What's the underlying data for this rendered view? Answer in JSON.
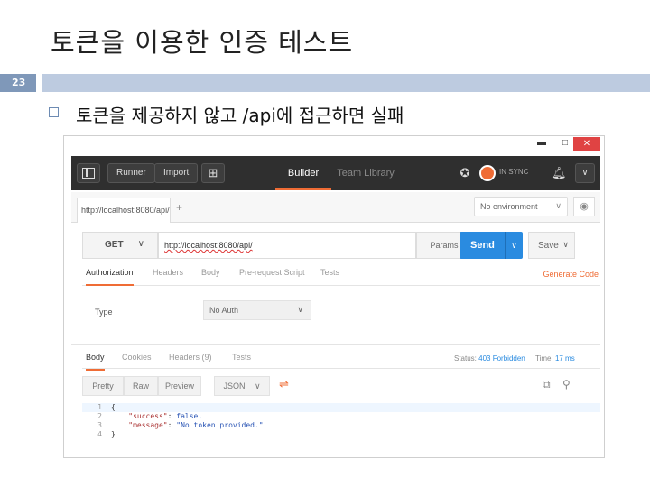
{
  "slide": {
    "title": "토큰을 이용한 인증 테스트",
    "page_number": "23",
    "bullet_text": "토큰을 제공하지 않고 /api에 접근하면 실패"
  },
  "window": {
    "minimize": "▬",
    "maximize": "□",
    "close": "✕"
  },
  "toolbar": {
    "runner": "Runner",
    "import": "Import",
    "new_icon": "plus-box-icon",
    "builder": "Builder",
    "team_library": "Team Library",
    "sync_text": "IN SYNC",
    "chevron": "∨"
  },
  "tabs": {
    "request_tab": "http://localhost:8080/api/",
    "add": "+",
    "environment": "No environment",
    "env_chevron": "∨",
    "eye": "◉"
  },
  "request": {
    "method": "GET",
    "method_chevron": "∨",
    "url": "http://localhost:8080/api/",
    "params": "Params",
    "send": "Send",
    "send_chevron": "∨",
    "save": "Save",
    "save_chevron": "∨"
  },
  "request_tabs": [
    "Authorization",
    "Headers",
    "Body",
    "Pre-request Script",
    "Tests"
  ],
  "generate_code": "Generate Code",
  "auth": {
    "type_label": "Type",
    "type_value": "No Auth",
    "chevron": "∨"
  },
  "response": {
    "tabs": [
      "Body",
      "Cookies",
      "Headers (9)",
      "Tests"
    ],
    "status_label": "Status:",
    "status_value": "403 Forbidden",
    "time_label": "Time:",
    "time_value": "17 ms",
    "pretty": "Pretty",
    "raw": "Raw",
    "preview": "Preview",
    "format": "JSON",
    "format_chevron": "∨",
    "code_lines": [
      {
        "n": "1",
        "text": "{"
      },
      {
        "n": "2",
        "key": "\"success\"",
        "value": " false,"
      },
      {
        "n": "3",
        "key": "\"message\"",
        "value": " \"No token provided.\""
      },
      {
        "n": "4",
        "text": "}"
      }
    ]
  },
  "colors": {
    "accent": "#ef6c35",
    "send_blue": "#2a8be0",
    "toolbar_dark": "#2f2f2f"
  }
}
